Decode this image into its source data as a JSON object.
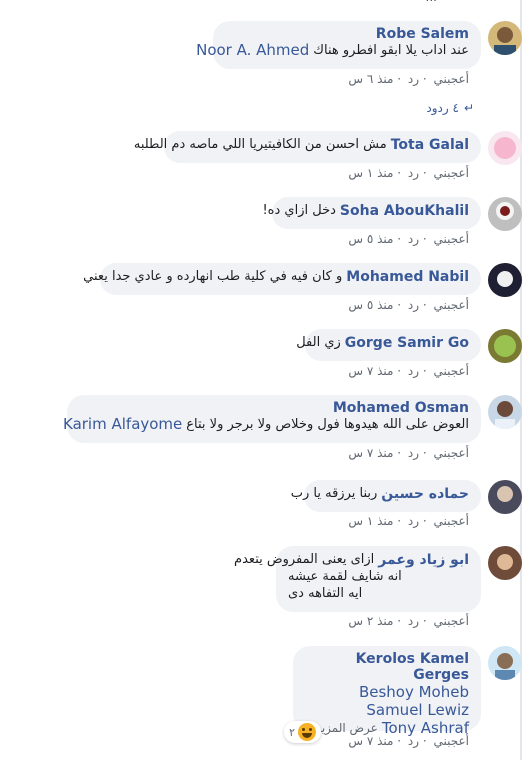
{
  "top_cut_text": "...",
  "replies_count": "٤ ردود",
  "comments": [
    {
      "name": "Robe Salem",
      "text": "عند اداب يلا ابقو افطرو هناك",
      "mention": "Noor A. Ahmed",
      "meta": [
        "أعجبني",
        "رد",
        "منذ ٦ س"
      ]
    },
    {
      "name": "Tota Galal",
      "text": "مش احسن من الكافيتيريا اللي ماصه دم الطلبه",
      "meta": [
        "أعجبني",
        "رد",
        "منذ ١ س"
      ]
    },
    {
      "name": "Soha AbouKhalil",
      "text": "دخل ازاي ده!",
      "meta": [
        "أعجبني",
        "رد",
        "منذ ٥ س"
      ]
    },
    {
      "name": "Mohamed Nabil",
      "text": "و كان فيه في كلية طب انهارده و عادي جدا يعني",
      "meta": [
        "أعجبني",
        "رد",
        "منذ ٥ س"
      ]
    },
    {
      "name": "Gorge Samir Go",
      "text": "زي الفل",
      "meta": [
        "أعجبني",
        "رد",
        "منذ ٧ س"
      ]
    },
    {
      "name": "Mohamed Osman",
      "text": "العوض على الله هيدوها فول وخلاص ولا برجر ولا بتاع",
      "mention": "Karim Alfayome",
      "meta": [
        "أعجبني",
        "رد",
        "منذ ٧ س"
      ]
    },
    {
      "name": "حماده حسين",
      "text": "ربنا يرزقه يا رب",
      "meta": [
        "أعجبني",
        "رد",
        "منذ ١ س"
      ]
    },
    {
      "name": "ابو زياد وعمر",
      "lines": [
        "ازاى يعنى المفروض يتعدم",
        "انه شايف لقمة عيشه",
        "ايه التفاهه دى"
      ],
      "meta": [
        "أعجبني",
        "رد",
        "منذ ٢ س"
      ]
    },
    {
      "name": "Kerolos Kamel Gerges",
      "mentions": [
        "Beshoy Moheb",
        "Samuel Lewiz",
        "Tony Ashraf"
      ],
      "see_more": "عرض المزيد...",
      "reaction_count": "٢",
      "meta": [
        "أعجبني",
        "رد",
        "منذ ٧ س"
      ]
    }
  ]
}
